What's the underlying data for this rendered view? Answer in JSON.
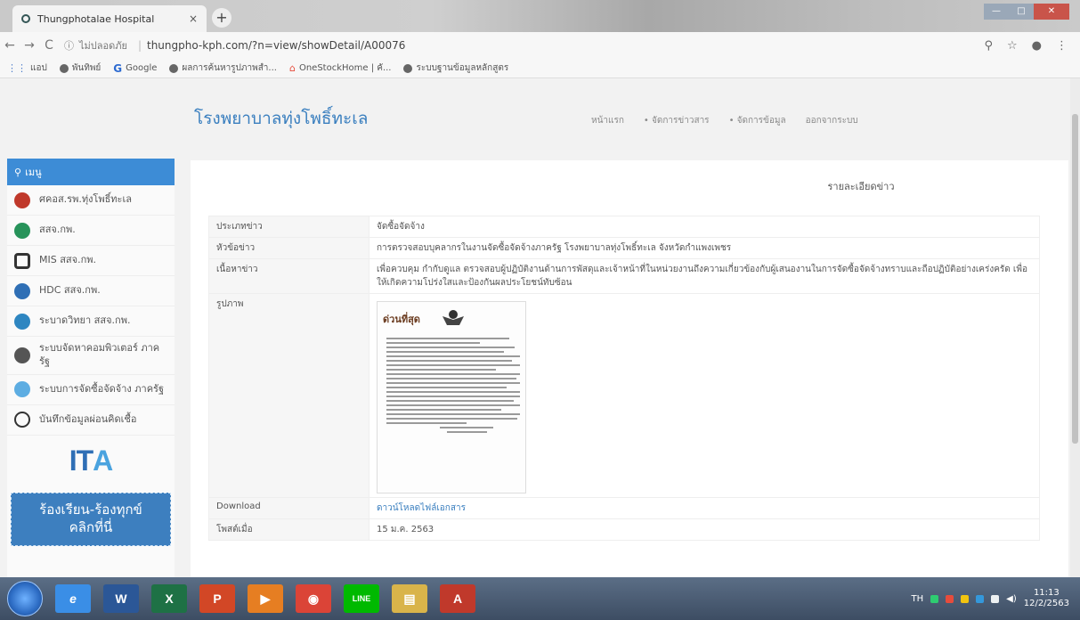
{
  "browser": {
    "tab_title": "Thungphotalae Hospital",
    "tab_close": "×",
    "new_tab": "+",
    "security_label": "ไม่ปลอดภัย",
    "url": "thungpho-kph.com/?n=view/showDetail/A00076",
    "bookmarks": [
      {
        "label": "แอป",
        "icon": "apps-icon"
      },
      {
        "label": "พันทิพย์",
        "icon": "globe-icon"
      },
      {
        "label": "Google",
        "icon": "google-icon"
      },
      {
        "label": "ผลการค้นหารูปภาพสำ...",
        "icon": "globe-icon"
      },
      {
        "label": "OneStockHome | คั...",
        "icon": "home-icon"
      },
      {
        "label": "ระบบฐานข้อมูลหลักสูตร",
        "icon": "globe-icon"
      }
    ]
  },
  "site": {
    "title": "โรงพยาบาลทุ่งโพธิ์ทะเล",
    "nav": [
      "หน้าแรก",
      "• จัดการข่าวสาร",
      "• จัดการข้อมูล",
      "ออกจากระบบ"
    ]
  },
  "sidebar": {
    "menu_label": "เมนู",
    "items": [
      {
        "label": "ศคอส.รพ.ทุ่งโพธิ์ทะเล",
        "icon": "logo-icon",
        "color": "#c0392b"
      },
      {
        "label": "สสจ.กพ.",
        "icon": "logo-icon",
        "color": "#27935a"
      },
      {
        "label": "MIS สสจ.กพ.",
        "icon": "network-icon",
        "color": "#333333"
      },
      {
        "label": "HDC สสจ.กพ.",
        "icon": "database-icon",
        "color": "#2f6fb5"
      },
      {
        "label": "ระบาดวิทยา สสจ.กพ.",
        "icon": "globe-icon",
        "color": "#2e86c1"
      },
      {
        "label": "ระบบจัดหาคอมพิวเตอร์ ภาครัฐ",
        "icon": "computer-icon",
        "color": "#555555"
      },
      {
        "label": "ระบบการจัดซื้อจัดจ้าง ภาครัฐ",
        "icon": "globe-icon",
        "color": "#5dade2"
      },
      {
        "label": "บันทึกข้อมูลผ่อนคิดเชื้อ",
        "icon": "biohazard-icon",
        "color": "#333333"
      }
    ],
    "ita_logo": "IT",
    "ita_logo_accent": "A",
    "complain_line1": "ร้องเรียน-ร้องทุกข์",
    "complain_line2": "คลิกที่นี่"
  },
  "content": {
    "heading": "รายละเอียดข่าว",
    "rows": [
      {
        "key": "ประเภทข่าว",
        "value": "จัดซื้อจัดจ้าง"
      },
      {
        "key": "หัวข้อข่าว",
        "value": "การตรวจสอบบุคลากรในงานจัดซื้อจัดจ้างภาครัฐ โรงพยาบาลทุ่งโพธิ์ทะเล จังหวัดกำแพงเพชร"
      },
      {
        "key": "เนื้อหาข่าว",
        "value": "เพื่อควบคุม กำกับดูแล ตรวจสอบผู้ปฏิบัติงานด้านการพัสดุและเจ้าหน้าที่ในหน่วยงานถึงความเกี่ยวข้องกับผู้เสนองานในการจัดซื้อจัดจ้างทราบและถือปฏิบัติอย่างเคร่งครัด เพื่อให้เกิดความโปร่งใสและป้องกันผลประโยชน์ทับซ้อน"
      },
      {
        "key": "รูปภาพ",
        "value": ""
      },
      {
        "key": "Download",
        "value": "ดาวน์โหลดไฟล์เอกสาร"
      },
      {
        "key": "โพสต์เมื่อ",
        "value": "15 ม.ค. 2563"
      }
    ],
    "doc_title": "ด่วนที่สุด"
  },
  "taskbar": {
    "apps": [
      {
        "name": "ie",
        "label": "e",
        "color": "#3a8ee6"
      },
      {
        "name": "word",
        "label": "W",
        "color": "#2b5797"
      },
      {
        "name": "excel",
        "label": "X",
        "color": "#1e7145"
      },
      {
        "name": "powerpoint",
        "label": "P",
        "color": "#d24726"
      },
      {
        "name": "media",
        "label": "▶",
        "color": "#e67e22"
      },
      {
        "name": "chrome",
        "label": "◉",
        "color": "#db4437"
      },
      {
        "name": "line",
        "label": "LINE",
        "color": "#00b900"
      },
      {
        "name": "explorer",
        "label": "▤",
        "color": "#d9b44a"
      },
      {
        "name": "acrobat",
        "label": "A",
        "color": "#c0392b"
      }
    ],
    "lang": "TH",
    "time": "11:13",
    "date": "12/2/2563"
  }
}
